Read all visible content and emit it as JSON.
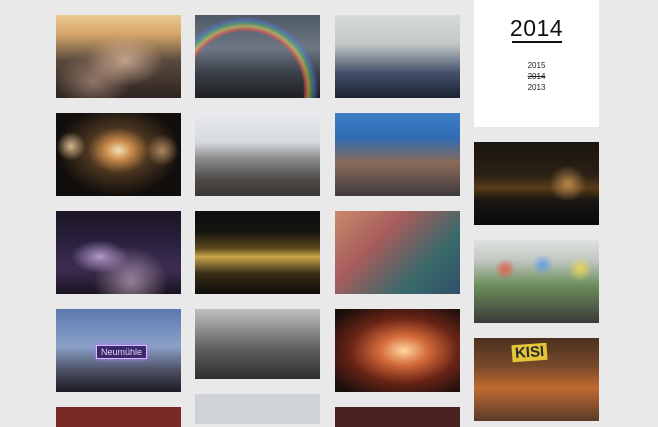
{
  "year_nav": {
    "title": "2014",
    "years": [
      "2015",
      "2014",
      "2013"
    ],
    "current": "2014"
  },
  "photos": {
    "p1_alt": "crowd with raised arms under tent",
    "p2_alt": "rainbow over festival stage",
    "p3_alt": "performer on stage with crowd",
    "p4_alt": "stage lights at night",
    "p5_alt": "large crowd in front of stage",
    "p6_alt": "fans at barrier",
    "p7_alt": "night stage with smoke",
    "p8_alt": "illuminated stage at night",
    "p9_alt": "fans cheering close-up",
    "p10_alt": "Neumühle sign over crowd",
    "p11_alt": "black and white aerial of harbor",
    "p12_alt": "crowd in smoke and light",
    "p13_alt": "harbor at night with lights",
    "p14_alt": "fans with colorful hats",
    "p15_alt": "KISI food stand",
    "sign_text": "Neumühle",
    "kiosk_text": "KISI"
  }
}
